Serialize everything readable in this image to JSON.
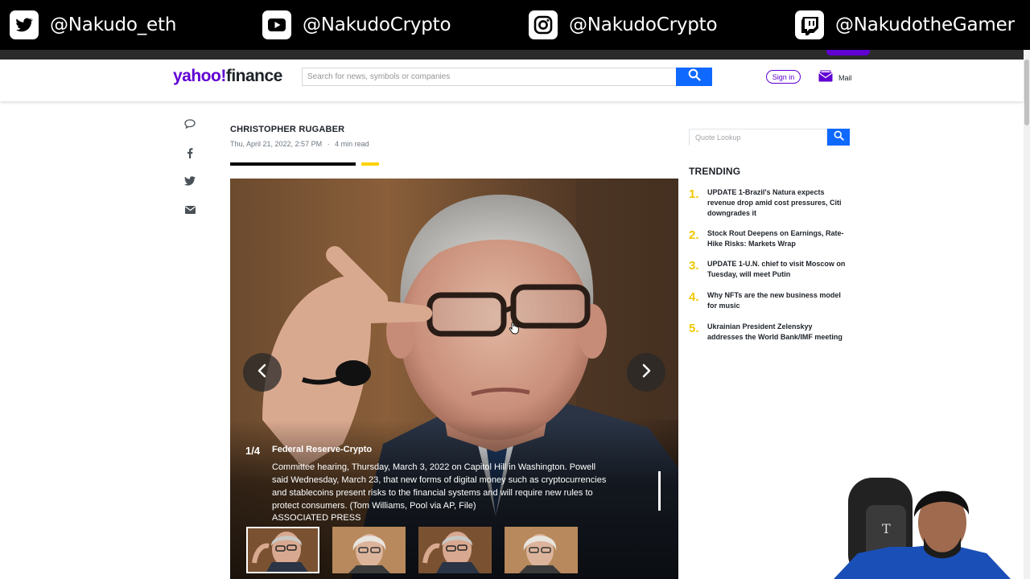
{
  "stream_overlay": {
    "socials": [
      {
        "platform": "twitter-icon",
        "handle": "@Nakudo_eth"
      },
      {
        "platform": "youtube-icon",
        "handle": "@NakudoCrypto"
      },
      {
        "platform": "instagram-icon",
        "handle": "@NakudoCrypto"
      },
      {
        "platform": "twitch-icon",
        "handle": "@NakudotheGamer"
      }
    ]
  },
  "header": {
    "logo_primary": "yahoo!",
    "logo_secondary": "finance",
    "search_placeholder": "Search for news, symbols or companies",
    "signin_label": "Sign in",
    "mail_label": "Mail"
  },
  "article": {
    "author": "CHRISTOPHER RUGABER",
    "date": "Thu, April 21, 2022, 2:57 PM",
    "read_time": "4 min read",
    "meta_separator": "·"
  },
  "share_icons": [
    "comment-icon",
    "facebook-icon",
    "twitter-icon",
    "email-icon"
  ],
  "slideshow": {
    "counter": "1/4",
    "title": "Federal Reserve-Crypto",
    "caption": "Committee hearing, Thursday, March 3, 2022 on Capitol Hill in Washington. Powell said Wednesday, March 23, that new forms of digital money such as cryptocurrencies and stablecoins present risks to the financial systems and will require new rules to protect consumers. (Tom Williams, Pool via AP, File)",
    "credit": "ASSOCIATED PRESS",
    "thumbnail_count": 4,
    "active_thumbnail": 1
  },
  "sidebar": {
    "quote_placeholder": "Quote Lookup",
    "trending_title": "TRENDING",
    "trending": [
      {
        "num": "1.",
        "text": "UPDATE 1-Brazil's Natura expects revenue drop amid cost pressures, Citi downgrades it"
      },
      {
        "num": "2.",
        "text": "Stock Rout Deepens on Earnings, Rate-Hike Risks: Markets Wrap"
      },
      {
        "num": "3.",
        "text": "UPDATE 1-U.N. chief to visit Moscow on Tuesday, will meet Putin"
      },
      {
        "num": "4.",
        "text": "Why NFTs are the new business model for music"
      },
      {
        "num": "5.",
        "text": "Ukrainian President Zelenskyy addresses the World Bank/IMF meeting"
      }
    ]
  },
  "colors": {
    "brand_purple": "#6001d2",
    "search_blue": "#0f69ff",
    "trending_yellow": "#f0c800",
    "overlay_black": "#000000"
  }
}
